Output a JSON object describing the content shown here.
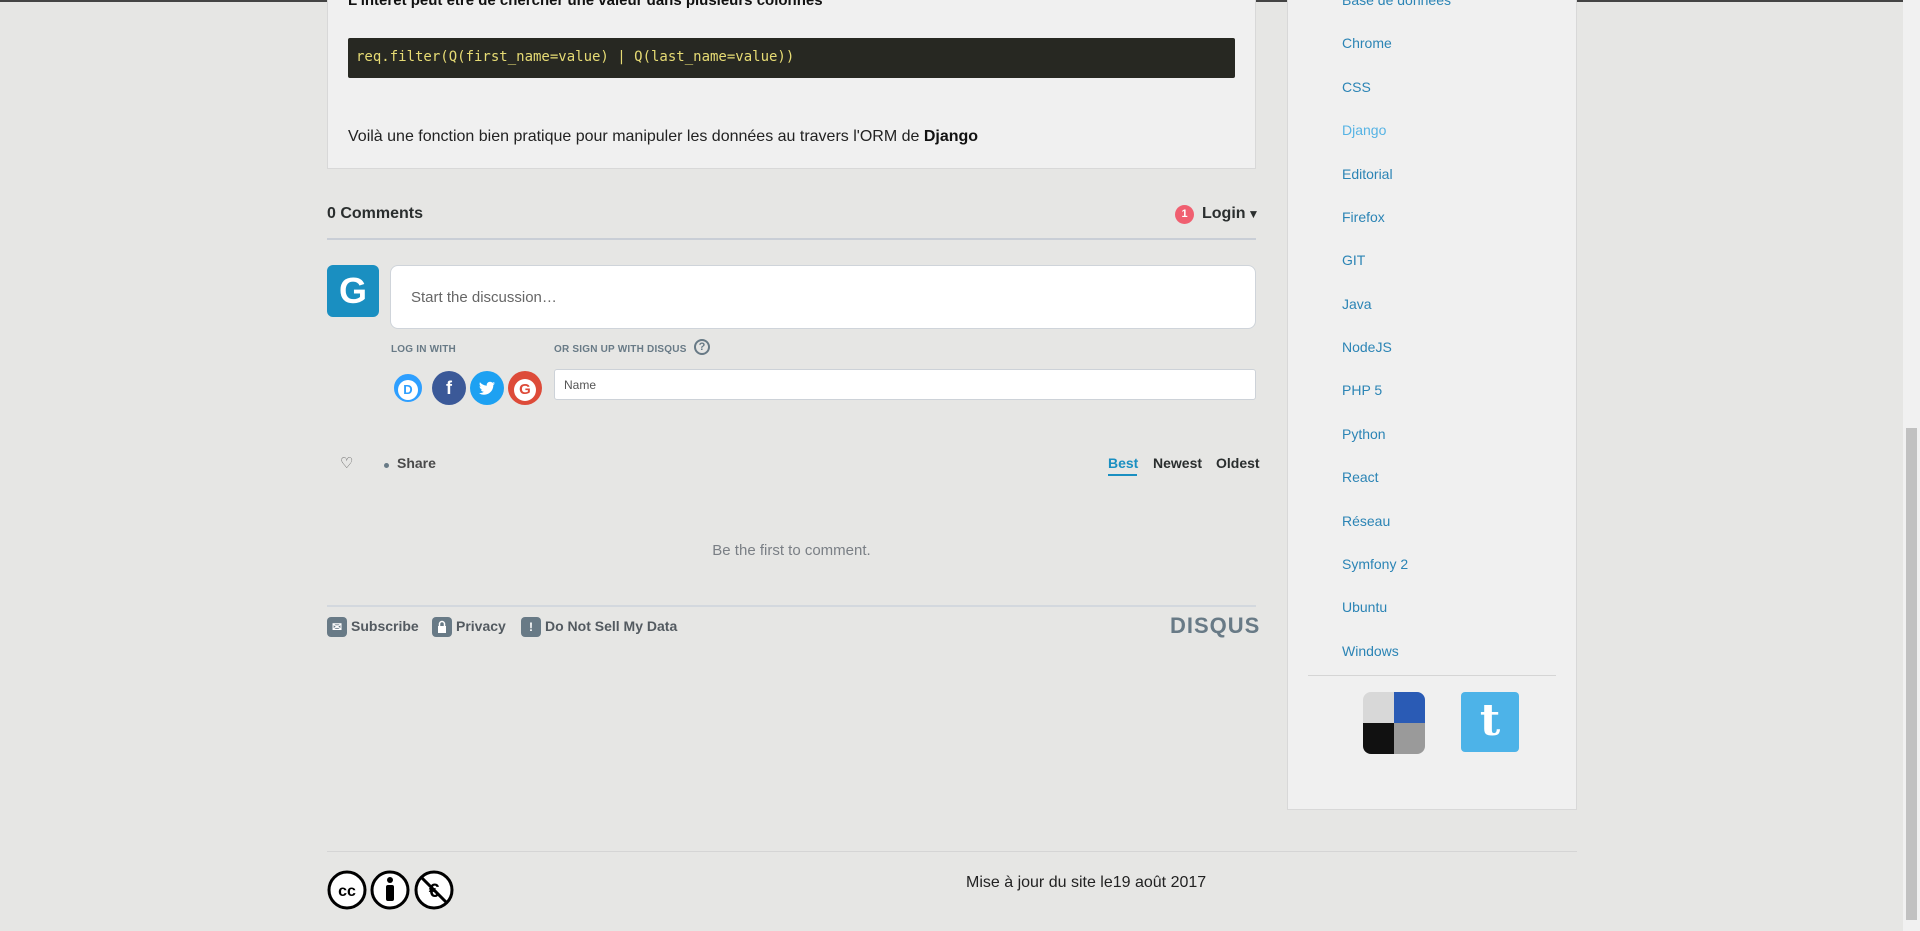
{
  "article": {
    "heading": "L'intérêt peut être de chercher une valeur dans plusieurs colonnes",
    "code": "req.filter(Q(first_name=value) | Q(last_name=value))",
    "text_before": "Voilà une fonction bien pratique pour manipuler les données au travers l'ORM de ",
    "text_bold": "Django"
  },
  "disqus": {
    "comments_count": "0 Comments",
    "notification_count": "1",
    "login_label": "Login",
    "avatar_letter": "G",
    "discussion_placeholder": "Start the discussion…",
    "log_in_with": "LOG IN WITH",
    "or_sign_up": "OR SIGN UP WITH DISQUS",
    "help": "?",
    "name_placeholder": "Name",
    "social": [
      {
        "name": "disqus",
        "glyph": "D",
        "color": "#2e9fff"
      },
      {
        "name": "facebook",
        "glyph": "f",
        "color": "#3b5998"
      },
      {
        "name": "twitter",
        "glyph": "t",
        "color": "#1da1f2"
      },
      {
        "name": "google",
        "glyph": "G",
        "color": "#dd4b39"
      }
    ],
    "share_label": "Share",
    "sort": {
      "best": "Best",
      "newest": "Newest",
      "oldest": "Oldest"
    },
    "empty_message": "Be the first to comment.",
    "footer": {
      "subscribe": "Subscribe",
      "privacy": "Privacy",
      "do_not_sell": "Do Not Sell My Data",
      "brand": "DISQUS"
    }
  },
  "sidebar": {
    "partial_top": "Base de données",
    "categories": [
      "Chrome",
      "CSS",
      "Django",
      "Editorial",
      "Firefox",
      "GIT",
      "Java",
      "NodeJS",
      "PHP 5",
      "Python",
      "React",
      "Réseau",
      "Symfony 2",
      "Ubuntu",
      "Windows"
    ],
    "active_category": "Django"
  },
  "footer": {
    "update_text": "Mise à jour du site le19 août 2017"
  },
  "colors": {
    "link": "#2b84b5",
    "active_link": "#56b3e4",
    "disqus_blue": "#1a8fc1",
    "badge_red": "#f05f70"
  }
}
